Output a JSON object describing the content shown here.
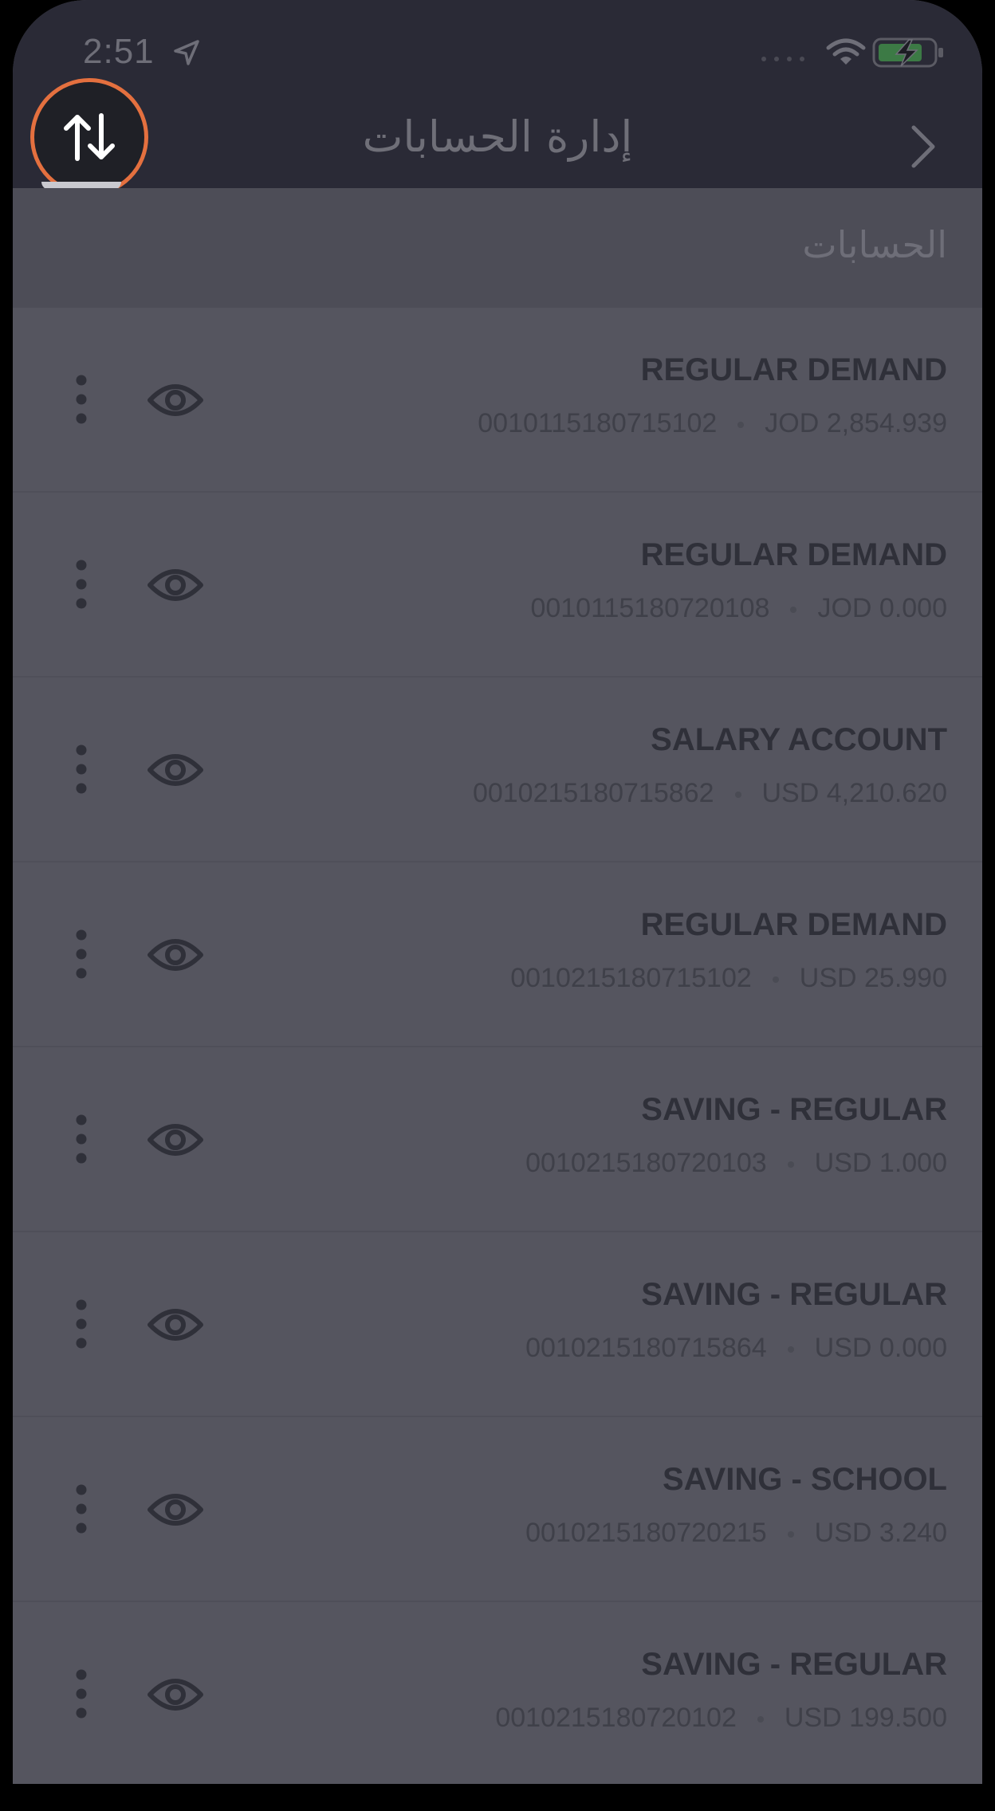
{
  "status_bar": {
    "time": "2:51",
    "icons": [
      "location-arrow-icon",
      "signal-dots-icon",
      "wifi-icon",
      "battery-charging-icon"
    ]
  },
  "header": {
    "title": "إدارة الحسابات",
    "back_icon": "chevron-right-icon",
    "sort_icon": "sort-arrows-icon"
  },
  "section": {
    "title": "الحسابات"
  },
  "accounts": [
    {
      "name": "REGULAR DEMAND",
      "number": "0010115180715102",
      "balance": "JOD 2,854.939"
    },
    {
      "name": "REGULAR DEMAND",
      "number": "0010115180720108",
      "balance": "JOD 0.000"
    },
    {
      "name": "SALARY ACCOUNT",
      "number": "0010215180715862",
      "balance": "USD 4,210.620"
    },
    {
      "name": "REGULAR DEMAND",
      "number": "0010215180715102",
      "balance": "USD 25.990"
    },
    {
      "name": "SAVING - REGULAR",
      "number": "0010215180720103",
      "balance": "USD 1.000"
    },
    {
      "name": "SAVING - REGULAR",
      "number": "0010215180715864",
      "balance": "USD 0.000"
    },
    {
      "name": "SAVING - SCHOOL",
      "number": "0010215180720215",
      "balance": "USD 3.240"
    },
    {
      "name": "SAVING - REGULAR",
      "number": "0010215180720102",
      "balance": "USD 199.500"
    }
  ],
  "colors": {
    "header_bg": "#2a2a36",
    "overlay_bg": "#55555f",
    "highlight_ring": "#e4703f"
  }
}
